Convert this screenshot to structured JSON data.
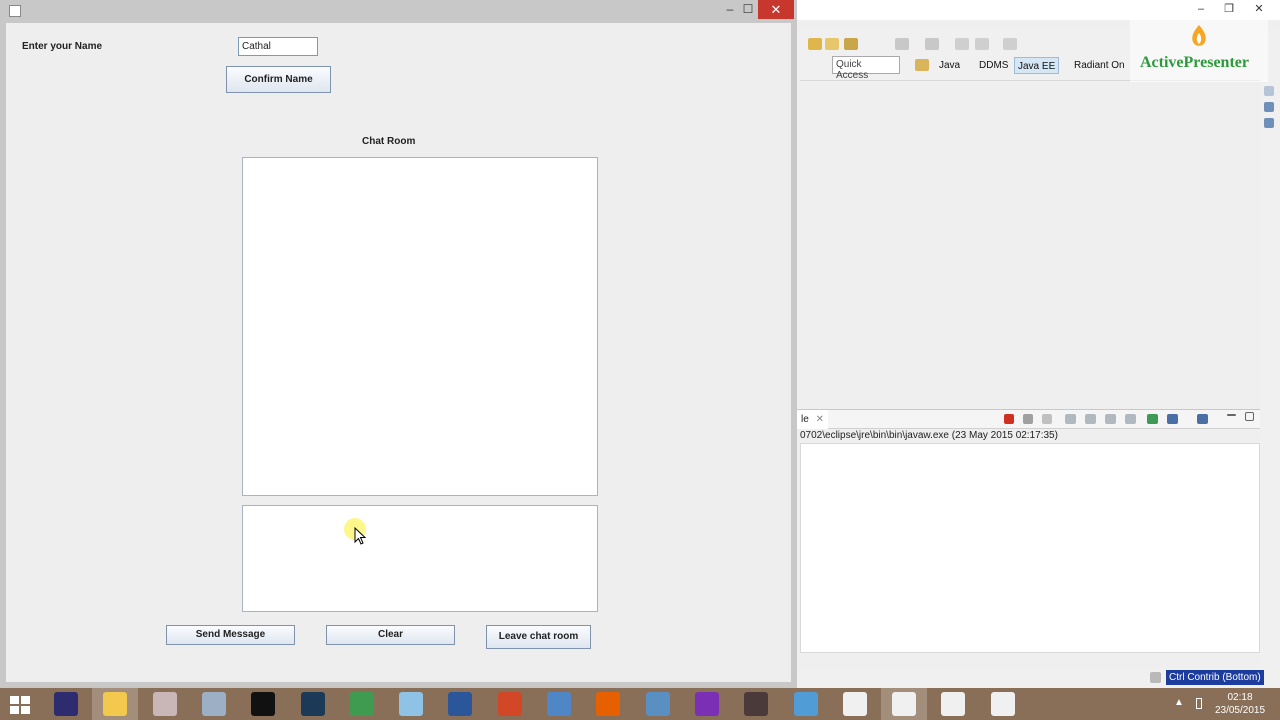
{
  "swing": {
    "name_label": "Enter your Name",
    "name_value": "Cathal",
    "confirm_label": "Confirm Name",
    "chat_room_label": "Chat Room",
    "send_label": "Send Message",
    "clear_label": "Clear",
    "leave_label": "Leave chat room",
    "window_controls": {
      "minimize": "–",
      "maximize": "☐",
      "close": "✕"
    }
  },
  "eclipse": {
    "window_controls": {
      "minimize": "–",
      "restore": "❐",
      "close": "✕"
    },
    "quick_access_placeholder": "Quick Access",
    "perspectives": [
      "Java",
      "DDMS",
      "Java EE",
      "Radiant On"
    ],
    "console_tab": "le",
    "console_tab_close": "✕",
    "console_path": "0702\\eclipse\\jre\\bin\\bin\\javaw.exe (23 May 2015 02:17:35)",
    "status_label": "Ctrl Contrib (Bottom)"
  },
  "watermark": {
    "text": "ActivePresenter"
  },
  "taskbar": {
    "time": "02:18",
    "date": "23/05/2015",
    "tray_arrow": "▲",
    "apps": [
      {
        "name": "eclipse-icon",
        "color": "#2c2c6e"
      },
      {
        "name": "file-explorer-icon",
        "color": "#f2c94c"
      },
      {
        "name": "snipping-tool-icon",
        "color": "#c9b7b7"
      },
      {
        "name": "files-icon",
        "color": "#9bb0c4"
      },
      {
        "name": "command-prompt-icon",
        "color": "#111111"
      },
      {
        "name": "mysql-icon",
        "color": "#1b3a57"
      },
      {
        "name": "chart-app-icon",
        "color": "#3f9b4f"
      },
      {
        "name": "notepad-icon",
        "color": "#8ec3e6"
      },
      {
        "name": "word-icon",
        "color": "#2b579a"
      },
      {
        "name": "powerpoint-icon",
        "color": "#d24726"
      },
      {
        "name": "jcreator-icon",
        "color": "#4f86c6"
      },
      {
        "name": "firefox-icon",
        "color": "#e66000"
      },
      {
        "name": "calculator-icon",
        "color": "#5a8fc2"
      },
      {
        "name": "search-app-icon",
        "color": "#7a2fb5"
      },
      {
        "name": "settings-app-icon",
        "color": "#4a3a3a"
      },
      {
        "name": "explorer-window-icon",
        "color": "#4f9cd6"
      },
      {
        "name": "java-icon-1",
        "color": "#f0f0f0"
      },
      {
        "name": "java-icon-2",
        "color": "#f0f0f0"
      },
      {
        "name": "java-icon-3",
        "color": "#f0f0f0"
      },
      {
        "name": "java-icon-4",
        "color": "#f0f0f0"
      }
    ]
  }
}
